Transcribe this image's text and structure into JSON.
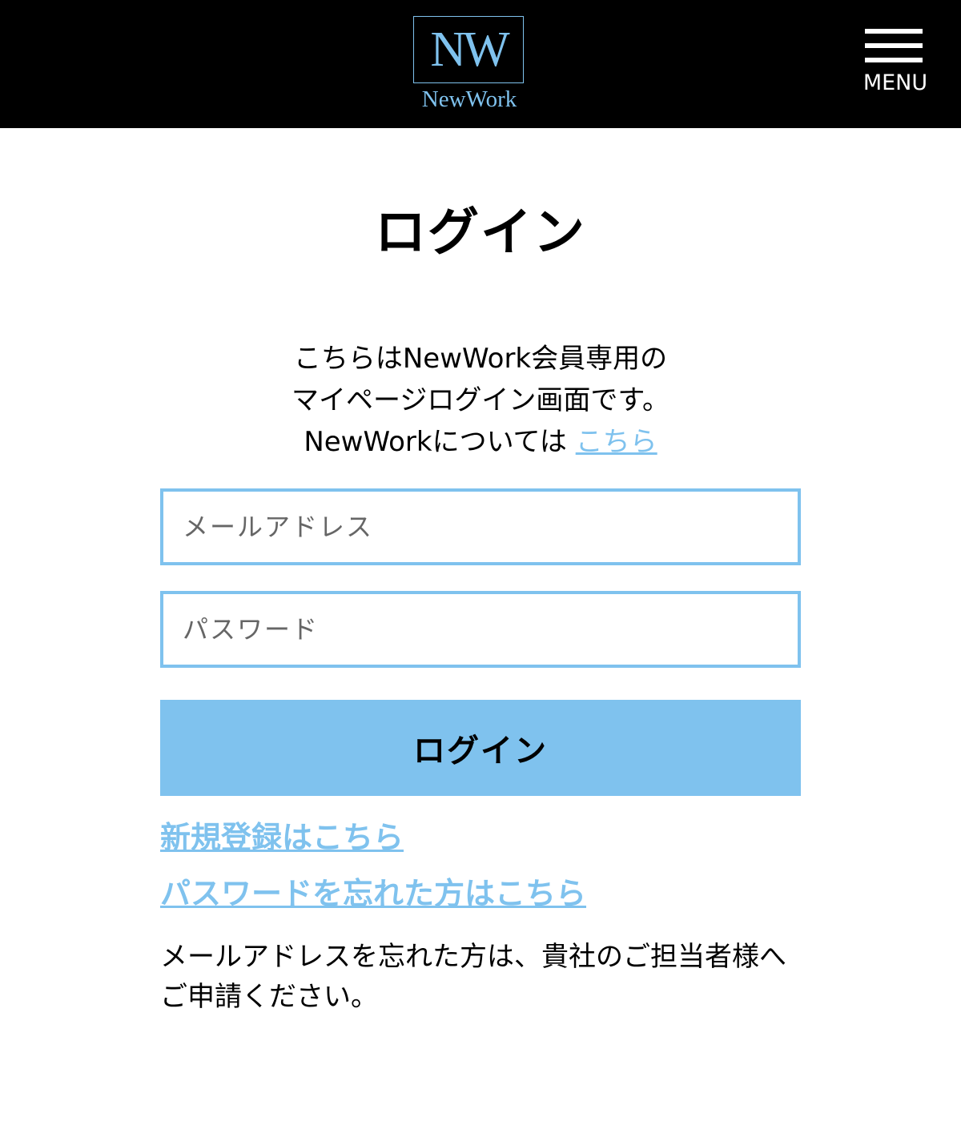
{
  "header": {
    "logo_mark": "NW",
    "logo_word": "NewWork",
    "menu_label": "MENU"
  },
  "page": {
    "title": "ログイン",
    "intro_line1": "こちらはNewWork会員専用の",
    "intro_line2": "マイページログイン画面です。",
    "intro_line3": "NewWorkについては ",
    "intro_link": "こちら"
  },
  "form": {
    "email_placeholder": "メールアドレス",
    "email_value": "",
    "password_placeholder": "パスワード",
    "password_value": "",
    "submit_label": "ログイン"
  },
  "links": {
    "register": "新規登録はこちら",
    "forgot_password": "パスワードを忘れた方はこちら"
  },
  "note": "メールアドレスを忘れた方は、貴社のご担当者様へご申請ください。",
  "colors": {
    "accent": "#7fc2ee",
    "header_bg": "#000000"
  }
}
